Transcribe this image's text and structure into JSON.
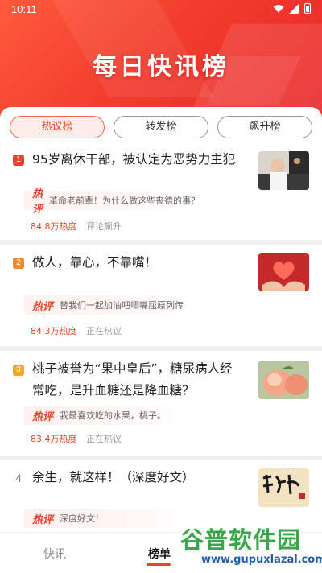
{
  "status_bar": {
    "time": "10:11"
  },
  "header": {
    "title": "每日快讯榜"
  },
  "tabs": [
    {
      "label": "热议榜",
      "active": true
    },
    {
      "label": "转发榜",
      "active": false
    },
    {
      "label": "飙升榜",
      "active": false
    }
  ],
  "items": [
    {
      "rank": "1",
      "title": "95岁离休干部，被认定为恶势力主犯",
      "hot_tag": "热评",
      "comment": "革命老前辈！为什么做这些丧德的事？",
      "heat": "84.8万热度",
      "status": "评论飙升",
      "thumb_icon": "elderly-man-photo"
    },
    {
      "rank": "2",
      "title": "做人，靠心，不靠嘴！",
      "hot_tag": "热评",
      "comment": "替我们一起加油吧唧嘴屈原列传",
      "heat": "84.3万热度",
      "status": "正在热议",
      "thumb_icon": "heart-in-hands-photo"
    },
    {
      "rank": "3",
      "title": "桃子被誉为“果中皇后”，糖尿病人经常吃，是升血糖还是降血糖？",
      "hot_tag": "热评",
      "comment": "我最喜欢吃的水果，桃子。",
      "heat": "83.4万热度",
      "status": "正在热议",
      "thumb_icon": "peach-photo"
    },
    {
      "rank": "4",
      "title": "余生，就这样！（深度好文）",
      "hot_tag": "热评",
      "comment": "深度好文！",
      "thumb_icon": "calligraphy-photo"
    }
  ],
  "bottom_nav": [
    {
      "label": "快讯",
      "active": false
    },
    {
      "label": "榜单",
      "active": true
    }
  ],
  "watermark": {
    "main": "谷普软件园",
    "sub": "www.gupuxlazal.com"
  },
  "colors": {
    "accent": "#e8452a",
    "header_red": "#f23d2e"
  }
}
